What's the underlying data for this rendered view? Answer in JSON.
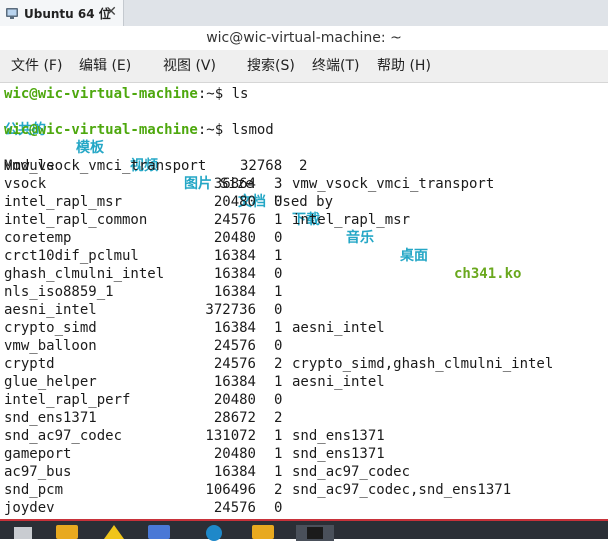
{
  "vm_tab": {
    "label": "Ubuntu 64 位",
    "close": "✕"
  },
  "window": {
    "title": "wic@wic-virtual-machine: ~"
  },
  "menu": [
    {
      "label": "文件 (F)"
    },
    {
      "label": "编辑 (E)"
    },
    {
      "label": "视图 (V)"
    },
    {
      "label": "搜索(S)"
    },
    {
      "label": "终端(T)"
    },
    {
      "label": "帮助 (H)"
    }
  ],
  "terminal": {
    "prompt1": {
      "user": "wic@wic-virtual-machine",
      "path": ":~$ ",
      "cmd": "ls"
    },
    "ls_entries": [
      "公共的",
      "模板",
      "视频",
      "图片",
      "文档",
      "下载",
      "音乐",
      "桌面",
      "ch341.ko"
    ],
    "prompt2": {
      "user": "wic@wic-virtual-machine",
      "path": ":~$ ",
      "cmd": "lsmod"
    },
    "header": {
      "module": "Module",
      "size": "Size",
      "used": "Used by"
    },
    "first_row": "vmw_vsock_vmci_transport    32768  2",
    "rows": [
      {
        "module": "vsock",
        "size": "36864",
        "count": "3",
        "used_by": "vmw_vsock_vmci_transport"
      },
      {
        "module": "intel_rapl_msr",
        "size": "20480",
        "count": "0",
        "used_by": ""
      },
      {
        "module": "intel_rapl_common",
        "size": "24576",
        "count": "1",
        "used_by": "intel_rapl_msr"
      },
      {
        "module": "coretemp",
        "size": "20480",
        "count": "0",
        "used_by": ""
      },
      {
        "module": "crct10dif_pclmul",
        "size": "16384",
        "count": "1",
        "used_by": ""
      },
      {
        "module": "ghash_clmulni_intel",
        "size": "16384",
        "count": "0",
        "used_by": ""
      },
      {
        "module": "nls_iso8859_1",
        "size": "16384",
        "count": "1",
        "used_by": ""
      },
      {
        "module": "aesni_intel",
        "size": "372736",
        "count": "0",
        "used_by": ""
      },
      {
        "module": "crypto_simd",
        "size": "16384",
        "count": "1",
        "used_by": "aesni_intel"
      },
      {
        "module": "vmw_balloon",
        "size": "24576",
        "count": "0",
        "used_by": ""
      },
      {
        "module": "cryptd",
        "size": "24576",
        "count": "2",
        "used_by": "crypto_simd,ghash_clmulni_intel"
      },
      {
        "module": "glue_helper",
        "size": "16384",
        "count": "1",
        "used_by": "aesni_intel"
      },
      {
        "module": "intel_rapl_perf",
        "size": "20480",
        "count": "0",
        "used_by": ""
      },
      {
        "module": "snd_ens1371",
        "size": "28672",
        "count": "2",
        "used_by": ""
      },
      {
        "module": "snd_ac97_codec",
        "size": "131072",
        "count": "1",
        "used_by": "snd_ens1371"
      },
      {
        "module": "gameport",
        "size": "20480",
        "count": "1",
        "used_by": "snd_ens1371"
      },
      {
        "module": "ac97_bus",
        "size": "16384",
        "count": "1",
        "used_by": "snd_ac97_codec"
      },
      {
        "module": "snd_pcm",
        "size": "106496",
        "count": "2",
        "used_by": "snd_ac97_codec,snd_ens1371"
      },
      {
        "module": "joydev",
        "size": "24576",
        "count": "0",
        "used_by": ""
      }
    ]
  },
  "colors": {
    "prompt": "#4ea80e",
    "directory": "#25a7c6",
    "kernel_module_file": "#6aa81e",
    "taskbar": "#2b2f36",
    "taskbar_accent": "#c8323a"
  },
  "taskbar_icons": [
    "window-icon",
    "folder-icon",
    "app-icon",
    "app-icon",
    "browser-icon",
    "folder-icon",
    "terminal-icon"
  ]
}
